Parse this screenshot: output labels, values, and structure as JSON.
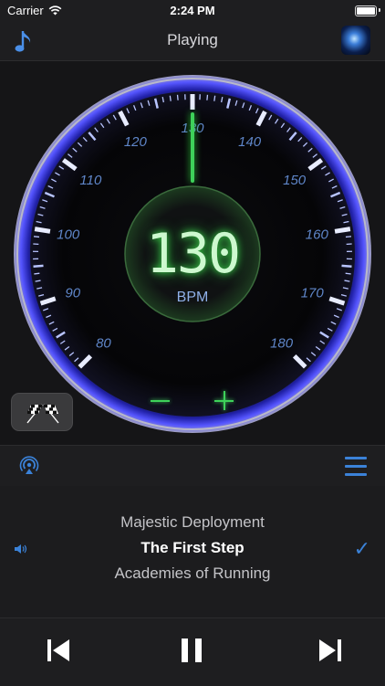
{
  "status_bar": {
    "carrier": "Carrier",
    "time": "2:24 PM"
  },
  "nav": {
    "title": "Playing",
    "left_icon": "music-note-icon",
    "right_icon": "app-logo-icon"
  },
  "gauge": {
    "value": "130",
    "unit": "BPM",
    "scale_labels": [
      "80",
      "90",
      "100",
      "110",
      "120",
      "130",
      "140",
      "150",
      "160",
      "170",
      "180"
    ],
    "needle_value": 130,
    "colors": {
      "ring": "#3a3ad8",
      "needle": "#3ed15a",
      "labels": "#5f86c9"
    }
  },
  "controls_row": {
    "left_button_icon": "checkered-flags-icon",
    "minus_icon": "minus-icon",
    "plus_icon": "plus-icon"
  },
  "toolbar": {
    "left_icon": "airplay-icon",
    "right_icon": "list-menu-icon"
  },
  "now_playing": {
    "artist": "Majestic Deployment",
    "song": "The First Step",
    "album": "Academies of Running"
  },
  "accent_color": "#3b82d8"
}
